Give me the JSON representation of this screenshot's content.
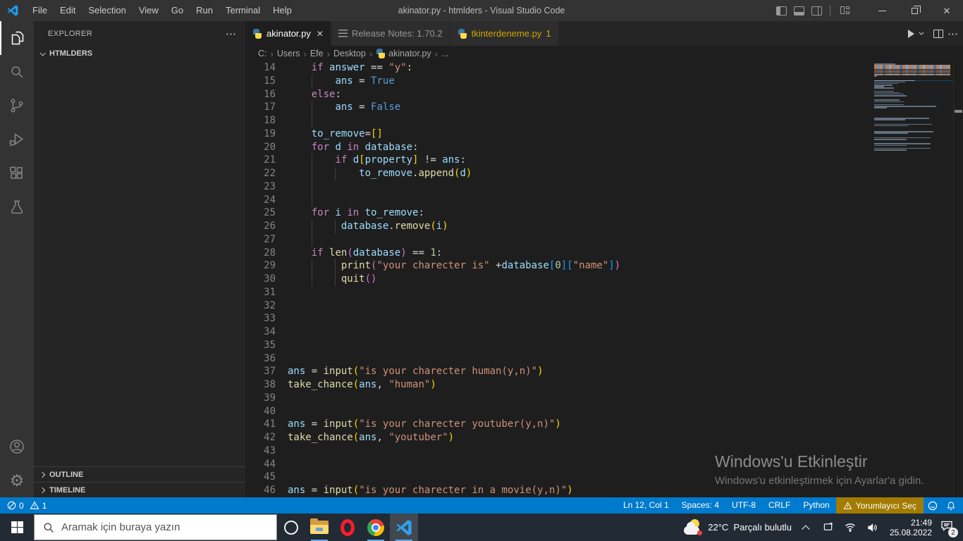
{
  "window": {
    "title": "akinator.py - htmlders - Visual Studio Code"
  },
  "menu": {
    "items": [
      "File",
      "Edit",
      "Selection",
      "View",
      "Go",
      "Run",
      "Terminal",
      "Help"
    ]
  },
  "activity_bar": {
    "icons": [
      "explorer",
      "search",
      "source-control",
      "run-debug",
      "extensions",
      "testing"
    ],
    "bottom_icons": [
      "accounts",
      "settings"
    ]
  },
  "sidebar": {
    "title": "EXPLORER",
    "actions_label": "⋯",
    "folder": {
      "label": "HTMLDERS"
    },
    "sections": [
      {
        "label": "OUTLINE"
      },
      {
        "label": "TIMELINE"
      }
    ]
  },
  "tabs": [
    {
      "label": "akinator.py",
      "icon": "python",
      "active": true,
      "close": "✕"
    },
    {
      "label": "Release Notes: 1.70.2",
      "icon": "release-notes",
      "active": false
    },
    {
      "label": "tkinterdeneme.py",
      "icon": "python",
      "active": false,
      "badge": "1",
      "warning_color": "#cca700"
    }
  ],
  "breadcrumb": {
    "parts": [
      {
        "label": "C:"
      },
      {
        "label": "Users"
      },
      {
        "label": "Efe"
      },
      {
        "label": "Desktop"
      },
      {
        "label": "akinator.py",
        "icon": "python"
      },
      {
        "label": "..."
      }
    ]
  },
  "editor": {
    "language": "Python",
    "lines": [
      {
        "n": 14,
        "g": [],
        "t": [
          [
            "    ",
            "w"
          ],
          [
            "if",
            "k"
          ],
          [
            " ",
            "w"
          ],
          [
            "answer",
            "v"
          ],
          [
            " == ",
            "w"
          ],
          [
            "\"y\"",
            "s"
          ],
          [
            ":",
            "w"
          ]
        ]
      },
      {
        "n": 15,
        "g": [
          4
        ],
        "t": [
          [
            "        ",
            "w"
          ],
          [
            "ans",
            "v"
          ],
          [
            " = ",
            "w"
          ],
          [
            "True",
            "c"
          ]
        ]
      },
      {
        "n": 16,
        "g": [],
        "t": [
          [
            "    ",
            "w"
          ],
          [
            "else",
            "k"
          ],
          [
            ":",
            "w"
          ]
        ]
      },
      {
        "n": 17,
        "g": [
          4
        ],
        "t": [
          [
            "        ",
            "w"
          ],
          [
            "ans",
            "v"
          ],
          [
            " = ",
            "w"
          ],
          [
            "False",
            "c"
          ]
        ]
      },
      {
        "n": 18,
        "g": [
          4
        ],
        "t": []
      },
      {
        "n": 19,
        "g": [],
        "t": [
          [
            "    ",
            "w"
          ],
          [
            "to_remove",
            "v"
          ],
          [
            "=",
            "w"
          ],
          [
            "[]",
            "g"
          ]
        ]
      },
      {
        "n": 20,
        "g": [],
        "t": [
          [
            "    ",
            "w"
          ],
          [
            "for",
            "k"
          ],
          [
            " ",
            "w"
          ],
          [
            "d",
            "v"
          ],
          [
            " ",
            "w"
          ],
          [
            "in",
            "k"
          ],
          [
            " ",
            "w"
          ],
          [
            "database",
            "v"
          ],
          [
            ":",
            "w"
          ]
        ]
      },
      {
        "n": 21,
        "g": [
          4
        ],
        "t": [
          [
            "        ",
            "w"
          ],
          [
            "if",
            "k"
          ],
          [
            " ",
            "w"
          ],
          [
            "d",
            "v"
          ],
          [
            "[",
            "g"
          ],
          [
            "property",
            "v"
          ],
          [
            "]",
            "g"
          ],
          [
            " != ",
            "w"
          ],
          [
            "ans",
            "v"
          ],
          [
            ":",
            "w"
          ]
        ]
      },
      {
        "n": 22,
        "g": [
          4,
          8
        ],
        "t": [
          [
            "            ",
            "w"
          ],
          [
            "to_remove",
            "v"
          ],
          [
            ".",
            "w"
          ],
          [
            "append",
            "f"
          ],
          [
            "(",
            "g"
          ],
          [
            "d",
            "v"
          ],
          [
            ")",
            "g"
          ]
        ]
      },
      {
        "n": 23,
        "g": [
          4
        ],
        "t": []
      },
      {
        "n": 24,
        "g": [
          4
        ],
        "t": []
      },
      {
        "n": 25,
        "g": [],
        "t": [
          [
            "    ",
            "w"
          ],
          [
            "for",
            "k"
          ],
          [
            " ",
            "w"
          ],
          [
            "i",
            "v"
          ],
          [
            " ",
            "w"
          ],
          [
            "in",
            "k"
          ],
          [
            " ",
            "w"
          ],
          [
            "to_remove",
            "v"
          ],
          [
            ":",
            "w"
          ]
        ]
      },
      {
        "n": 26,
        "g": [
          4,
          8
        ],
        "t": [
          [
            "         ",
            "w"
          ],
          [
            "database",
            "v"
          ],
          [
            ".",
            "w"
          ],
          [
            "remove",
            "f"
          ],
          [
            "(",
            "g"
          ],
          [
            "i",
            "v"
          ],
          [
            ")",
            "g"
          ]
        ]
      },
      {
        "n": 27,
        "g": [
          4
        ],
        "t": []
      },
      {
        "n": 28,
        "g": [],
        "t": [
          [
            "    ",
            "w"
          ],
          [
            "if",
            "k"
          ],
          [
            " ",
            "w"
          ],
          [
            "len",
            "f"
          ],
          [
            "(",
            "p"
          ],
          [
            "database",
            "v"
          ],
          [
            ")",
            "p"
          ],
          [
            " == ",
            "w"
          ],
          [
            "1",
            "n"
          ],
          [
            ":",
            "w"
          ]
        ]
      },
      {
        "n": 29,
        "g": [
          4,
          8
        ],
        "t": [
          [
            "         ",
            "w"
          ],
          [
            "print",
            "f"
          ],
          [
            "(",
            "p"
          ],
          [
            "\"your charecter is\"",
            "s"
          ],
          [
            " +",
            "w"
          ],
          [
            "database",
            "v"
          ],
          [
            "[",
            "b"
          ],
          [
            "0",
            "n"
          ],
          [
            "]",
            "b"
          ],
          [
            "[",
            "b"
          ],
          [
            "\"name\"",
            "s"
          ],
          [
            "]",
            "b"
          ],
          [
            ")",
            "p"
          ]
        ]
      },
      {
        "n": 30,
        "g": [
          4,
          8
        ],
        "t": [
          [
            "         ",
            "w"
          ],
          [
            "quit",
            "f"
          ],
          [
            "(",
            "p"
          ],
          [
            ")",
            "p"
          ]
        ]
      },
      {
        "n": 31,
        "g": [],
        "t": []
      },
      {
        "n": 32,
        "g": [],
        "t": []
      },
      {
        "n": 33,
        "g": [],
        "t": []
      },
      {
        "n": 34,
        "g": [],
        "t": []
      },
      {
        "n": 35,
        "g": [],
        "t": []
      },
      {
        "n": 36,
        "g": [],
        "t": []
      },
      {
        "n": 37,
        "g": [],
        "t": [
          [
            "ans",
            "v"
          ],
          [
            " = ",
            "w"
          ],
          [
            "input",
            "f"
          ],
          [
            "(",
            "g"
          ],
          [
            "\"is your charecter human(y,n)\"",
            "s"
          ],
          [
            ")",
            "g"
          ]
        ]
      },
      {
        "n": 38,
        "g": [],
        "t": [
          [
            "take_chance",
            "f"
          ],
          [
            "(",
            "g"
          ],
          [
            "ans",
            "v"
          ],
          [
            ", ",
            "w"
          ],
          [
            "\"human\"",
            "s"
          ],
          [
            ")",
            "g"
          ]
        ]
      },
      {
        "n": 39,
        "g": [],
        "t": []
      },
      {
        "n": 40,
        "g": [],
        "t": []
      },
      {
        "n": 41,
        "g": [],
        "t": [
          [
            "ans",
            "v"
          ],
          [
            " = ",
            "w"
          ],
          [
            "input",
            "f"
          ],
          [
            "(",
            "g"
          ],
          [
            "\"is your charecter youtuber(y,n)\"",
            "s"
          ],
          [
            ")",
            "g"
          ]
        ]
      },
      {
        "n": 42,
        "g": [],
        "t": [
          [
            "take_chance",
            "f"
          ],
          [
            "(",
            "g"
          ],
          [
            "ans",
            "v"
          ],
          [
            ", ",
            "w"
          ],
          [
            "\"youtuber\"",
            "s"
          ],
          [
            ")",
            "g"
          ]
        ]
      },
      {
        "n": 43,
        "g": [],
        "t": []
      },
      {
        "n": 44,
        "g": [],
        "t": []
      },
      {
        "n": 45,
        "g": [],
        "t": []
      },
      {
        "n": 46,
        "g": [],
        "t": [
          [
            "ans",
            "v"
          ],
          [
            " = ",
            "w"
          ],
          [
            "input",
            "f"
          ],
          [
            "(",
            "g"
          ],
          [
            "\"is your charecter in a movie(y,n)\"",
            "s"
          ],
          [
            ")",
            "g"
          ]
        ]
      }
    ]
  },
  "minimap": {
    "rows": [
      [
        "s",
        30
      ],
      [
        "d",
        108
      ],
      [
        "d",
        108
      ],
      [
        "d",
        108
      ],
      [
        "d",
        108
      ],
      [
        "d",
        108
      ],
      [
        "d",
        108
      ],
      [
        "d",
        108
      ],
      [
        "s",
        4
      ],
      [
        "b",
        0
      ],
      [
        "b",
        0
      ],
      [
        "h",
        58
      ],
      [
        "s",
        44
      ],
      [
        "s",
        34
      ],
      [
        "s",
        26
      ],
      [
        "s",
        14
      ],
      [
        "s",
        28
      ],
      [
        "b",
        0
      ],
      [
        "s",
        28
      ],
      [
        "s",
        36
      ],
      [
        "s",
        42
      ],
      [
        "s",
        46
      ],
      [
        "b",
        0
      ],
      [
        "b",
        0
      ],
      [
        "s",
        36
      ],
      [
        "s",
        42
      ],
      [
        "b",
        0
      ],
      [
        "s",
        42
      ],
      [
        "s",
        88
      ],
      [
        "s",
        18
      ],
      [
        "b",
        0
      ],
      [
        "b",
        0
      ],
      [
        "b",
        0
      ],
      [
        "b",
        0
      ],
      [
        "b",
        0
      ],
      [
        "b",
        0
      ],
      [
        "s",
        78
      ],
      [
        "s",
        44
      ],
      [
        "b",
        0
      ],
      [
        "b",
        0
      ],
      [
        "s",
        82
      ],
      [
        "s",
        48
      ],
      [
        "b",
        0
      ],
      [
        "b",
        0
      ],
      [
        "b",
        0
      ],
      [
        "s",
        84
      ],
      [
        "s",
        48
      ],
      [
        "b",
        0
      ],
      [
        "b",
        0
      ],
      [
        "s",
        80
      ],
      [
        "s",
        46
      ],
      [
        "b",
        0
      ],
      [
        "b",
        0
      ],
      [
        "s",
        80
      ],
      [
        "s",
        46
      ],
      [
        "b",
        0
      ],
      [
        "s",
        80
      ],
      [
        "s",
        46
      ]
    ]
  },
  "watermark": {
    "line1": "Windows'u Etkinleştir",
    "line2": "Windows'u etkinleştirmek için Ayarlar'a gidin."
  },
  "status_bar": {
    "errors": "0",
    "warnings": "1",
    "items": [
      "Ln 12, Col 1",
      "Spaces: 4",
      "UTF-8",
      "CRLF",
      "Python"
    ],
    "warning_item": "Yorumlayıcı Seç",
    "warning_item_bg": "#a27b00",
    "accent": "#007acc"
  },
  "taskbar": {
    "search_placeholder": "Aramak için buraya yazın",
    "weather_temp": "22°C",
    "weather_condition": "Parçalı bulutlu",
    "time": "21:49",
    "date": "25.08.2022",
    "notification_count": "2"
  }
}
